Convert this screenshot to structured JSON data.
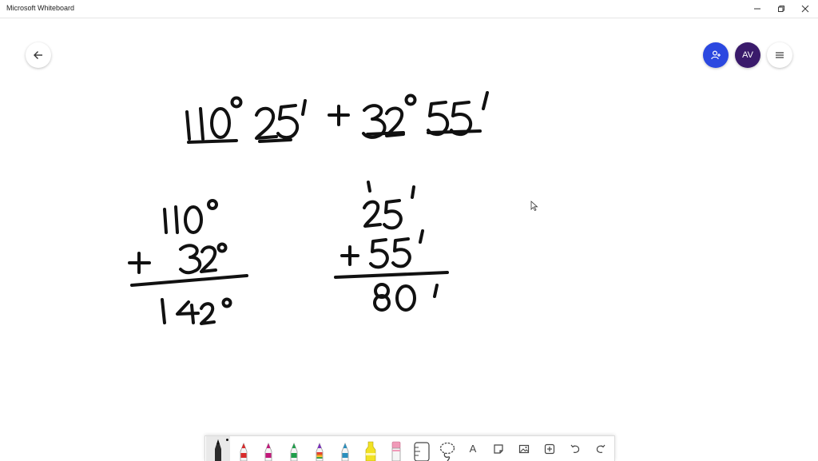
{
  "window": {
    "title": "Microsoft Whiteboard"
  },
  "canvas": {
    "avatar_initials": "AV"
  },
  "toolbar": {
    "pens": [
      {
        "name": "black-pen",
        "color": "#111111"
      },
      {
        "name": "red-pen",
        "color": "#d92b2b"
      },
      {
        "name": "magenta-pen",
        "color": "#c2187a"
      },
      {
        "name": "green-pen",
        "color": "#1e9e4a"
      },
      {
        "name": "rainbow-pen",
        "color": "#e46b1c"
      },
      {
        "name": "galaxy-pen",
        "color": "#2a8fbd"
      },
      {
        "name": "highlighter",
        "color": "#f2e224"
      }
    ],
    "text_tool_label": "A"
  },
  "colors": {
    "ink": "#111111",
    "share": "#2b48e0",
    "avatar": "#3a1a6b"
  },
  "ink": {
    "expression": "110° 25′ + 32° 55′",
    "left_sum": {
      "top": "110°",
      "bottom": "+ 32°",
      "result": "142°"
    },
    "right_sum": {
      "carry": "1",
      "top": "25′",
      "bottom": "+ 55′",
      "result": "80′"
    }
  }
}
